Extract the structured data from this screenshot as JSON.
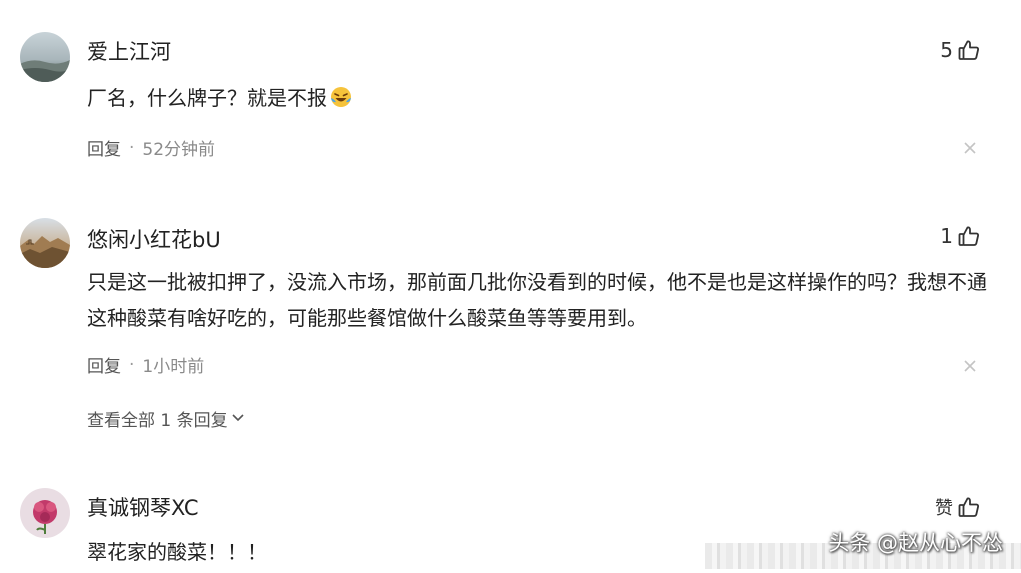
{
  "comments": [
    {
      "username": "爱上江河",
      "likes": "5",
      "text": "厂名，什么牌子？就是不报",
      "reply_label": "回复",
      "separator": "·",
      "time": "52分钟前"
    },
    {
      "username": "悠闲小红花bU",
      "likes": "1",
      "text": "只是这一批被扣押了，没流入市场，那前面几批你没看到的时候，他不是也是这样操作的吗？我想不通这种酸菜有啥好吃的，可能那些餐馆做什么酸菜鱼等等要用到。",
      "reply_label": "回复",
      "separator": "·",
      "time": "1小时前",
      "view_all": "查看全部 1 条回复"
    },
    {
      "username": "真诚钢琴XC",
      "likes": "赞",
      "text": "翠花家的酸菜！！！"
    }
  ],
  "watermark": "头条 @赵从心不怂",
  "icons": {
    "like": "thumbs-up-icon",
    "close": "close-icon",
    "chevron": "chevron-down-icon",
    "emoji": "laughing-emoji-icon"
  }
}
